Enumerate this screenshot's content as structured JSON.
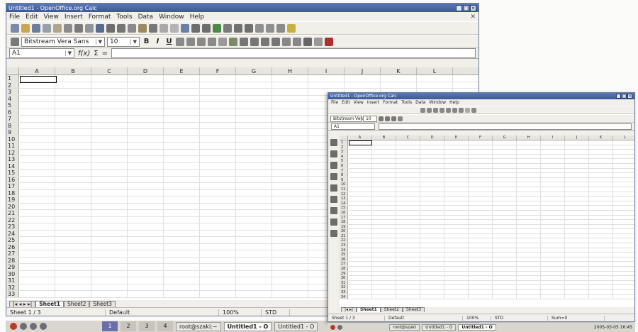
{
  "main": {
    "title": "Untitled1 - OpenOffice.org Calc",
    "window_buttons": [
      "_",
      "□",
      "✕"
    ],
    "menu": [
      "File",
      "Edit",
      "View",
      "Insert",
      "Format",
      "Tools",
      "Data",
      "Window",
      "Help"
    ],
    "close_doc": "✕",
    "font_name": "Bitstream Vera Sans",
    "font_size": "10",
    "bold": "B",
    "italic": "I",
    "underline": "U",
    "cell_ref": "A1",
    "fx": "f(x)",
    "sum": "Σ",
    "equals": "=",
    "columns": [
      "A",
      "B",
      "C",
      "D",
      "E",
      "F",
      "G",
      "H",
      "I",
      "J",
      "K",
      "L"
    ],
    "rows": [
      "1",
      "2",
      "3",
      "4",
      "5",
      "6",
      "7",
      "8",
      "9",
      "10",
      "11",
      "12",
      "13",
      "14",
      "15",
      "16",
      "17",
      "18",
      "19",
      "20",
      "21",
      "22",
      "23",
      "24",
      "25",
      "26",
      "27",
      "28",
      "29",
      "30",
      "31",
      "32",
      "33"
    ],
    "sheet_tabs": [
      "Sheet1",
      "Sheet2",
      "Sheet3"
    ],
    "status": {
      "sheet": "Sheet 1 / 3",
      "style": "Default",
      "zoom": "100%",
      "mode": "STD"
    }
  },
  "taskbar": {
    "workspaces": [
      "1",
      "2",
      "3",
      "4"
    ],
    "tasks": [
      "root@szaki:~",
      "Untitled1 - O",
      "Untitled1 - O"
    ]
  },
  "small": {
    "title": "Untitled1 - OpenOffice.org Calc",
    "window_buttons": [
      "_",
      "□",
      "✕"
    ],
    "menu": [
      "File",
      "Edit",
      "View",
      "Insert",
      "Format",
      "Tools",
      "Data",
      "Window",
      "Help"
    ],
    "font_name": "Bitstream Vera S",
    "font_size": "10",
    "cell_ref": "A1",
    "columns": [
      "A",
      "B",
      "C",
      "D",
      "E",
      "F",
      "G",
      "H",
      "I",
      "J",
      "K",
      "L"
    ],
    "rows": [
      "1",
      "2",
      "3",
      "4",
      "5",
      "6",
      "7",
      "8",
      "9",
      "10",
      "11",
      "12",
      "13",
      "14",
      "15",
      "16",
      "17",
      "18",
      "19",
      "20",
      "21",
      "22",
      "23",
      "24",
      "25",
      "26",
      "27",
      "28",
      "29",
      "30",
      "31",
      "32",
      "33",
      "34"
    ],
    "sheet_tabs": [
      "Sheet1",
      "Sheet2",
      "Sheet3"
    ],
    "status": {
      "sheet": "Sheet 1 / 3",
      "style": "Default",
      "zoom": "100%",
      "mode": "STD",
      "sum": "Sum=0"
    },
    "taskbar_tasks": [
      "root@szaki",
      "Untitled1 - O",
      "Untitled1 - O"
    ],
    "clock": "2005-03-05 16:45"
  }
}
